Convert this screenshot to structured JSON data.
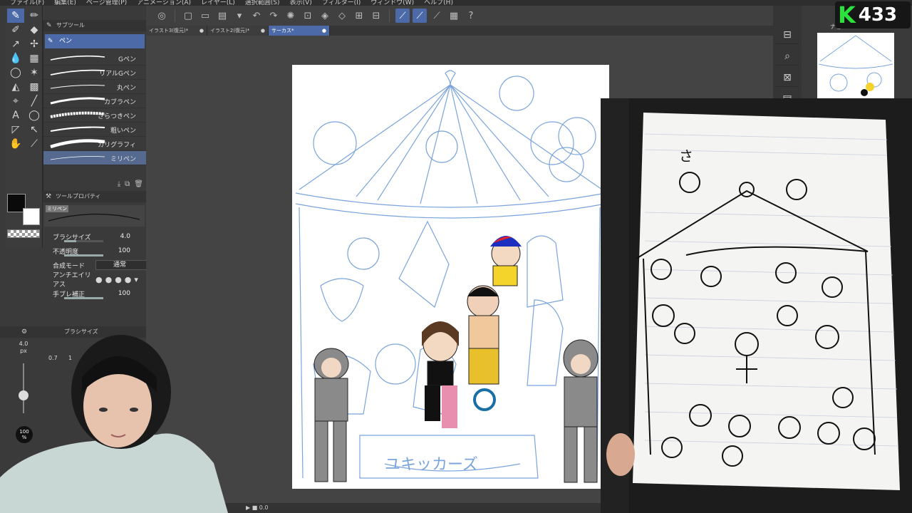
{
  "menu": [
    "ファイル(F)",
    "編集(E)",
    "ページ管理(P)",
    "アニメーション(A)",
    "レイヤー(L)",
    "選択範囲(S)",
    "表示(V)",
    "フィルター(I)",
    "ウィンドウ(W)",
    "ヘルプ(H)"
  ],
  "subtool_panel": {
    "title": "サブツール",
    "group": "ペン",
    "brushes": [
      {
        "label": "Gペン"
      },
      {
        "label": "リアルGペン"
      },
      {
        "label": "丸ペン"
      },
      {
        "label": "カブラペン"
      },
      {
        "label": "ざらつきペン"
      },
      {
        "label": "粗いペン"
      },
      {
        "label": "カリグラフィ"
      },
      {
        "label": "ミリペン"
      }
    ]
  },
  "tool_property": {
    "title": "ツールプロパティ",
    "preview_tag": "ミリペン",
    "rows": [
      {
        "name": "ブラシサイズ",
        "value": "4.0",
        "level": 0.3
      },
      {
        "name": "不透明度",
        "value": "100",
        "level": 1.0
      },
      {
        "name": "合成モード",
        "value": "通常"
      },
      {
        "name": "アンチエイリアス",
        "value": ""
      },
      {
        "name": "手ブレ補正",
        "value": "100",
        "level": 1.0
      }
    ]
  },
  "brush_size_panel": {
    "title": "ブラシサイズ",
    "current": "4.0",
    "unit": "px",
    "presets": [
      "0.7",
      "1"
    ],
    "zoom": "100",
    "zoom_unit": "%"
  },
  "tabs": [
    {
      "label": "イラスト3(復元)*",
      "active": false
    },
    {
      "label": "イラスト2(復元)*",
      "active": false
    },
    {
      "label": "サーカス*",
      "active": true
    }
  ],
  "canvas_text": "ユキッカーズ",
  "status": {
    "zoom": "0.0"
  },
  "navigator": {
    "title": "ナビ"
  },
  "score_badge": {
    "letter": "K",
    "number": "433"
  },
  "photo_sheet": {
    "caption": "さ"
  },
  "colors": {
    "accent": "#4d6aa8",
    "main_color": "#0a0a0a",
    "sub_color": "#ffffff",
    "sketch_blue": "#7ba4dc",
    "badge_green": "#29e23a"
  }
}
